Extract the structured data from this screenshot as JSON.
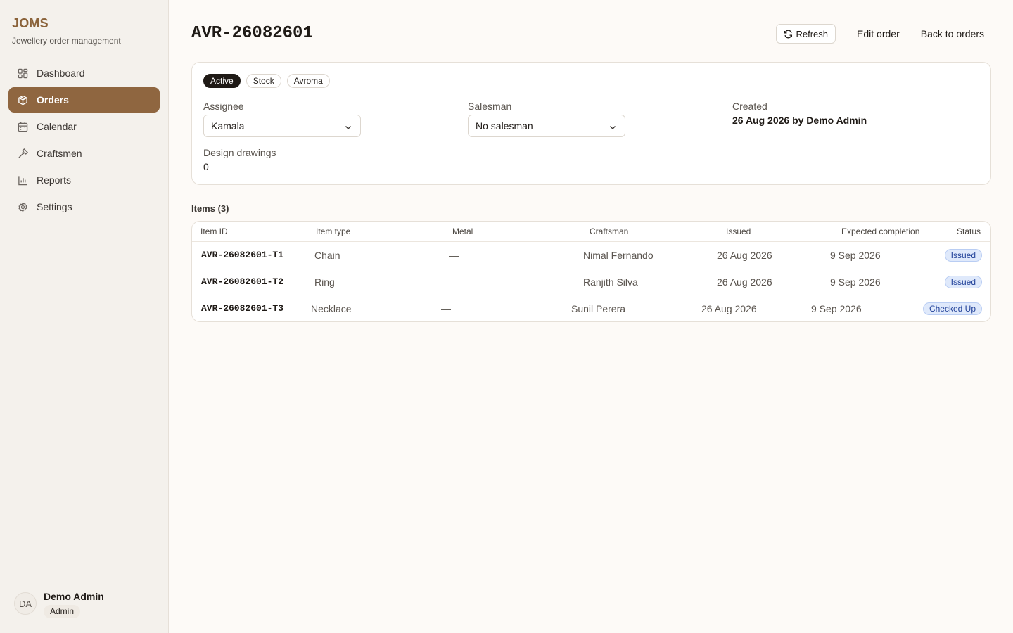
{
  "brand": {
    "title": "JOMS",
    "subtitle": "Jewellery order management"
  },
  "nav": [
    {
      "label": "Dashboard",
      "icon": "dashboard-icon"
    },
    {
      "label": "Orders",
      "icon": "box-icon",
      "active": true
    },
    {
      "label": "Calendar",
      "icon": "calendar-icon"
    },
    {
      "label": "Craftsmen",
      "icon": "hammer-icon"
    },
    {
      "label": "Reports",
      "icon": "bar-chart-icon"
    },
    {
      "label": "Settings",
      "icon": "gear-icon"
    }
  ],
  "user": {
    "initials": "DA",
    "name": "Demo Admin",
    "role": "Admin"
  },
  "header": {
    "title": "AVR-26082601",
    "refresh_label": "Refresh",
    "edit_label": "Edit order",
    "back_label": "Back to orders"
  },
  "order": {
    "tags": [
      "Active",
      "Stock",
      "Avroma"
    ],
    "assignee_label": "Assignee",
    "assignee_value": "Kamala",
    "salesman_label": "Salesman",
    "salesman_value": "No salesman",
    "created_label": "Created",
    "created_value": "26 Aug 2026 by Demo Admin",
    "drawings_label": "Design drawings",
    "drawings_value": "0"
  },
  "items": {
    "title": "Items (3)",
    "columns": [
      "Item ID",
      "Item type",
      "Metal",
      "Craftsman",
      "Issued",
      "Expected completion",
      "Status"
    ],
    "rows": [
      {
        "id": "AVR-26082601-T1",
        "type": "Chain",
        "metal": "—",
        "craftsman": "Nimal Fernando",
        "issued": "26 Aug 2026",
        "expected": "9 Sep 2026",
        "status": "Issued"
      },
      {
        "id": "AVR-26082601-T2",
        "type": "Ring",
        "metal": "—",
        "craftsman": "Ranjith Silva",
        "issued": "26 Aug 2026",
        "expected": "9 Sep 2026",
        "status": "Issued"
      },
      {
        "id": "AVR-26082601-T3",
        "type": "Necklace",
        "metal": "—",
        "craftsman": "Sunil Perera",
        "issued": "26 Aug 2026",
        "expected": "9 Sep 2026",
        "status": "Checked Up"
      }
    ]
  },
  "colors": {
    "accent": "#8f6640",
    "brand": "#8a6239",
    "badge_bg": "#dfe9fb",
    "badge_text": "#23439a"
  }
}
